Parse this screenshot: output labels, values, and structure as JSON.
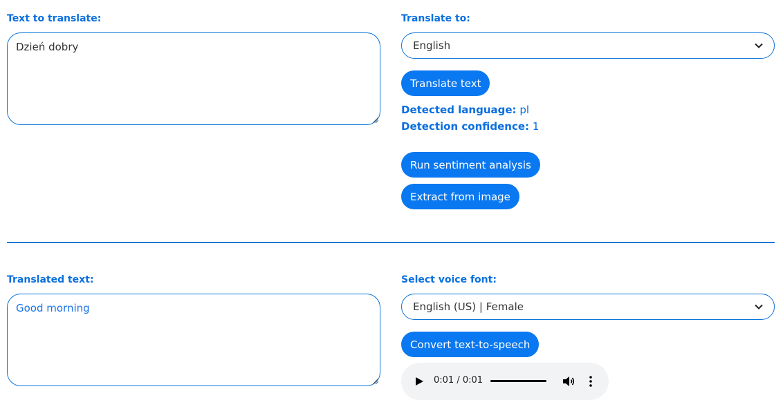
{
  "source": {
    "label": "Text to translate:",
    "text": "Dzień dobry"
  },
  "translate_to": {
    "label": "Translate to:",
    "selected": "English",
    "button": "Translate text"
  },
  "detection": {
    "language_label": "Detected language:",
    "language_value": "pl",
    "confidence_label": "Detection confidence:",
    "confidence_value": "1"
  },
  "actions": {
    "sentiment": "Run sentiment analysis",
    "extract": "Extract from image"
  },
  "translated": {
    "label": "Translated text:",
    "text": "Good morning"
  },
  "voice": {
    "label": "Select voice font:",
    "selected": "English (US) | Female",
    "button": "Convert text-to-speech"
  },
  "player": {
    "time": "0:01 / 0:01"
  },
  "colors": {
    "accent": "#0a78f0",
    "label": "#0a6fe0"
  },
  "icons": {
    "play": "play-icon",
    "volume": "volume-icon",
    "more": "more-vertical-icon",
    "chevron": "chevron-down-icon"
  }
}
